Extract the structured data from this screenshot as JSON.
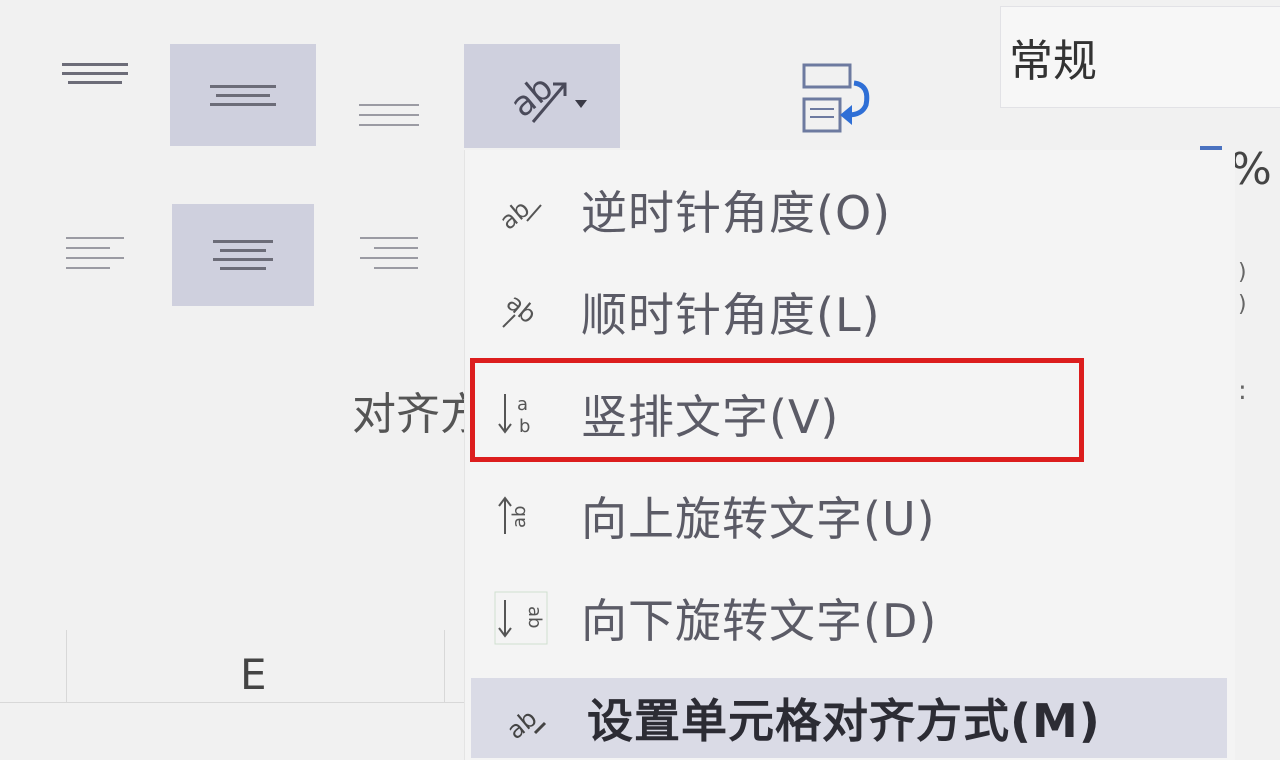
{
  "ribbon": {
    "number_format_value": "常规",
    "group_label": "对齐方",
    "column_header": "E"
  },
  "right_strip": {
    "percent_glyph": "%",
    "paren_top": ")",
    "paren_bottom": ")",
    "colon_glyph": ":"
  },
  "menu": {
    "items": [
      {
        "label": "逆时针角度(O)",
        "icon": "counterclockwise-angle-icon"
      },
      {
        "label": "顺时针角度(L)",
        "icon": "clockwise-angle-icon"
      },
      {
        "label": "竖排文字(V)",
        "icon": "vertical-text-icon"
      },
      {
        "label": "向上旋转文字(U)",
        "icon": "rotate-text-up-icon"
      },
      {
        "label": "向下旋转文字(D)",
        "icon": "rotate-text-down-icon"
      }
    ],
    "footer_label": "设置单元格对齐方式(M)"
  },
  "colors": {
    "active_button": "#cfd0de",
    "highlight_box": "#dc1d1d",
    "footer_bg": "#dadbe6"
  }
}
